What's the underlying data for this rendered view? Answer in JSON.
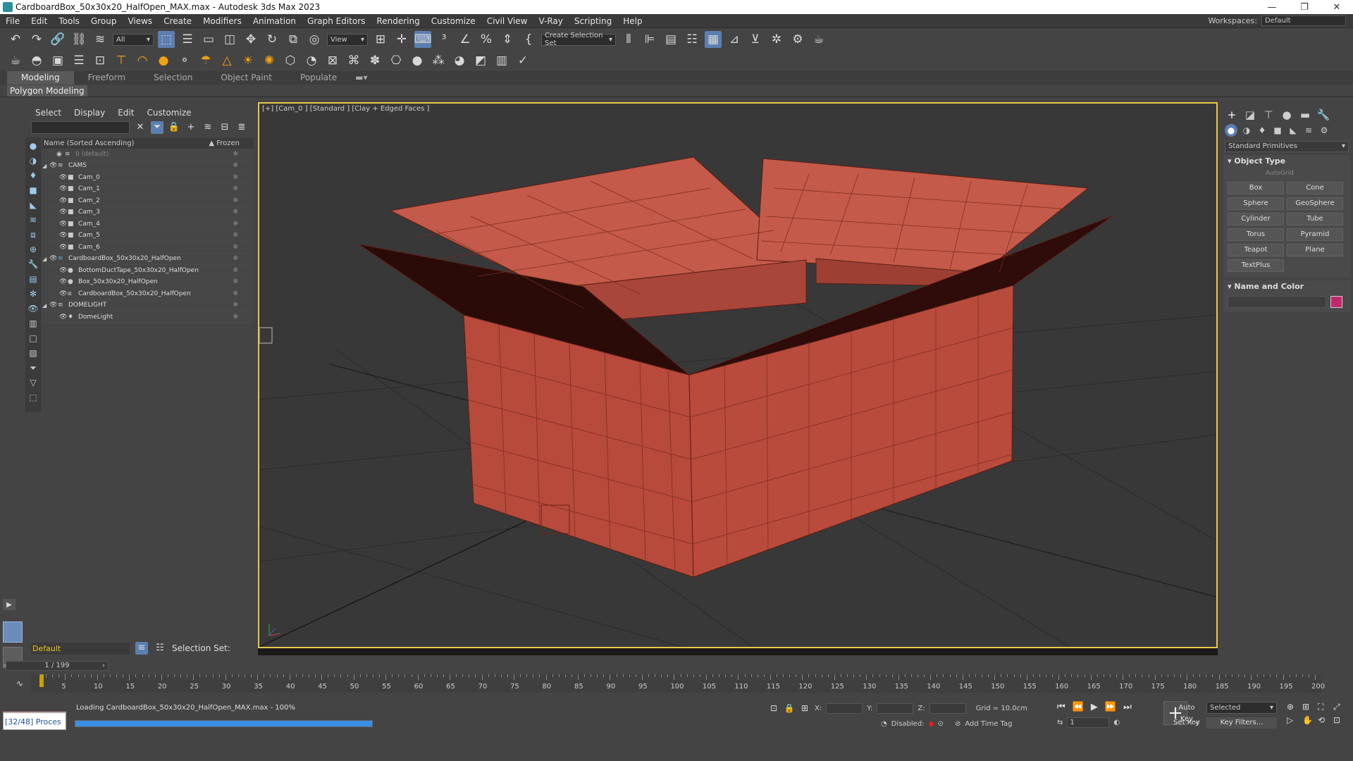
{
  "window": {
    "title": "CardboardBox_50x30x20_HalfOpen_MAX.max - Autodesk 3ds Max 2023",
    "buttons": [
      "—",
      "❐",
      "✕"
    ]
  },
  "menu": {
    "items": [
      "File",
      "Edit",
      "Tools",
      "Group",
      "Views",
      "Create",
      "Modifiers",
      "Animation",
      "Graph Editors",
      "Rendering",
      "Customize",
      "Civil View",
      "V-Ray",
      "Scripting",
      "Help"
    ],
    "workspaces_label": "Workspaces:",
    "workspaces_value": "Default"
  },
  "toolbar": {
    "filter_value": "All",
    "refcoord_value": "View",
    "selection_set_value": "Create Selection Set"
  },
  "ribbon": {
    "tabs": [
      "Modeling",
      "Freeform",
      "Selection",
      "Object Paint",
      "Populate"
    ],
    "active_tab": "Modeling",
    "subpanel": "Polygon Modeling"
  },
  "explorer": {
    "menu": [
      "Select",
      "Display",
      "Edit",
      "Customize"
    ],
    "header_name": "Name (Sorted Ascending)",
    "header_frozen": "Frozen",
    "rows": [
      {
        "label": "0 (default)",
        "dim": true
      },
      {
        "label": "CAMS"
      },
      {
        "label": "Cam_0"
      },
      {
        "label": "Cam_1"
      },
      {
        "label": "Cam_2"
      },
      {
        "label": "Cam_3"
      },
      {
        "label": "Cam_4"
      },
      {
        "label": "Cam_5"
      },
      {
        "label": "Cam_6"
      },
      {
        "label": "CardboardBox_50x30x20_HalfOpen"
      },
      {
        "label": "BottomDuctTape_50x30x20_HalfOpen"
      },
      {
        "label": "Box_50x30x20_HalfOpen"
      },
      {
        "label": "CardboardBox_50x30x20_HalfOpen"
      },
      {
        "label": "DOMELIGHT"
      },
      {
        "label": "DomeLight"
      }
    ],
    "layer_value": "Default",
    "selection_set_label": "Selection Set:"
  },
  "viewport": {
    "label": "[+] [Cam_0 ] [Standard ] [Clay + Edged Faces ]"
  },
  "command_panel": {
    "category": "Standard Primitives",
    "object_type_title": "Object Type",
    "autogrid": "AutoGrid",
    "primitives": [
      "Box",
      "Cone",
      "Sphere",
      "GeoSphere",
      "Cylinder",
      "Tube",
      "Torus",
      "Pyramid",
      "Teapot",
      "Plane",
      "TextPlus"
    ],
    "name_color_title": "Name and Color",
    "swatch_color": "#c2286e"
  },
  "timeline": {
    "slider": "1 / 199",
    "ticks": [
      "5",
      "10",
      "15",
      "20",
      "25",
      "30",
      "35",
      "40",
      "45",
      "50",
      "55",
      "60",
      "65",
      "70",
      "75",
      "80",
      "85",
      "90",
      "95",
      "100",
      "105",
      "110",
      "115",
      "120",
      "125",
      "130",
      "135",
      "140",
      "145",
      "150",
      "155",
      "160",
      "165",
      "170",
      "175",
      "180",
      "185",
      "190",
      "195",
      "200"
    ]
  },
  "status": {
    "process": "[32/48] Proces",
    "message": "Loading CardboardBox_50x30x20_HalfOpen_MAX.max  -  100%",
    "progress": 1.0,
    "x_label": "X:",
    "y_label": "Y:",
    "z_label": "Z:",
    "grid": "Grid = 10.0cm",
    "disabled": "Disabled:",
    "add_time_tag": "Add Time Tag",
    "auto_key": "Auto Key",
    "set_key": "Set Key",
    "selected": "Selected",
    "key_filters": "Key Filters...",
    "frame_value": "1"
  },
  "colors": {
    "accent": "#5b7fb0",
    "viewport_border": "#e8c94a",
    "box_color": "#b9493a",
    "progress": "#3a8ee6"
  }
}
